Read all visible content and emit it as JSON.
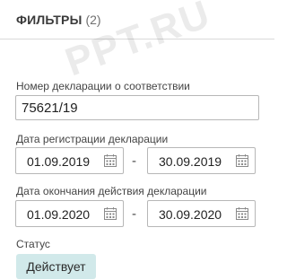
{
  "header": {
    "title": "ФИЛЬТРЫ",
    "count": "(2)"
  },
  "watermark": "PPT.RU",
  "declaration_number": {
    "label": "Номер декларации о соответствии",
    "value": "75621/19"
  },
  "registration_date": {
    "label": "Дата регистрации декларации",
    "from": "01.09.2019",
    "separator": "-",
    "to": "30.09.2019"
  },
  "expiration_date": {
    "label": "Дата окончания действия декларации",
    "from": "01.09.2020",
    "separator": "-",
    "to": "30.09.2020"
  },
  "status": {
    "label": "Статус",
    "value": "Действует",
    "badge_color": "#d1e9ea"
  },
  "icons": {
    "date_picker": "calendar-icon"
  }
}
